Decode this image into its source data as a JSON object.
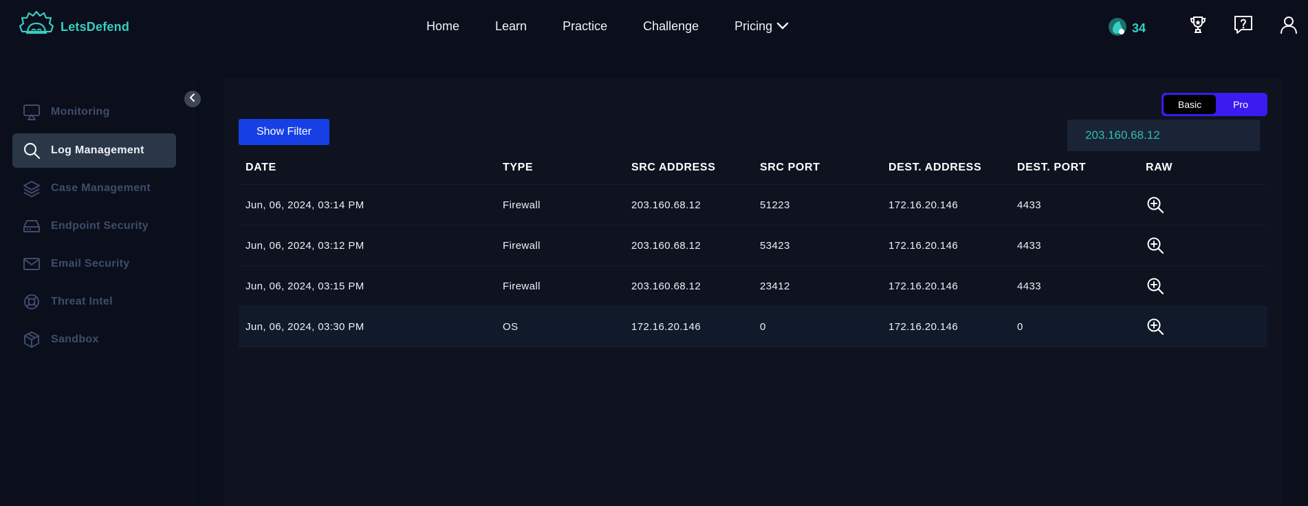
{
  "brand": {
    "name": "LetsDefend"
  },
  "nav": {
    "items": [
      "Home",
      "Learn",
      "Practice",
      "Challenge",
      "Pricing"
    ]
  },
  "user_tools": {
    "points": "34",
    "icons": [
      "leaderboard-icon",
      "help-icon",
      "user-icon"
    ]
  },
  "sidebar": {
    "items": [
      {
        "label": "Monitoring",
        "icon": "monitor-icon",
        "active": false
      },
      {
        "label": "Log Management",
        "icon": "search-icon",
        "active": true
      },
      {
        "label": "Case Management",
        "icon": "layers-icon",
        "active": false
      },
      {
        "label": "Endpoint Security",
        "icon": "hard-drive-icon",
        "active": false
      },
      {
        "label": "Email Security",
        "icon": "mail-icon",
        "active": false
      },
      {
        "label": "Threat Intel",
        "icon": "lifebuoy-icon",
        "active": false
      },
      {
        "label": "Sandbox",
        "icon": "cube-icon",
        "active": false
      }
    ]
  },
  "mode_toggle": {
    "basic": "Basic",
    "pro": "Pro",
    "selected": "Basic"
  },
  "filter": {
    "button_label": "Show Filter",
    "search_value": "203.160.68.12"
  },
  "table": {
    "columns": [
      "DATE",
      "TYPE",
      "SRC ADDRESS",
      "SRC PORT",
      "DEST. ADDRESS",
      "DEST. PORT",
      "RAW"
    ],
    "rows": [
      [
        "Jun, 06, 2024, 03:14 PM",
        "Firewall",
        "203.160.68.12",
        "51223",
        "172.16.20.146",
        "4433"
      ],
      [
        "Jun, 06, 2024, 03:12 PM",
        "Firewall",
        "203.160.68.12",
        "53423",
        "172.16.20.146",
        "4433"
      ],
      [
        "Jun, 06, 2024, 03:15 PM",
        "Firewall",
        "203.160.68.12",
        "23412",
        "172.16.20.146",
        "4433"
      ],
      [
        "Jun, 06, 2024, 03:30 PM",
        "OS",
        "172.16.20.146",
        "0",
        "172.16.20.146",
        "0"
      ]
    ]
  },
  "colors": {
    "accent_teal": "#35d0c3",
    "primary_blue": "#1640e6",
    "toggle_purple": "#3a1bf0",
    "background": "#0b0e1b"
  }
}
